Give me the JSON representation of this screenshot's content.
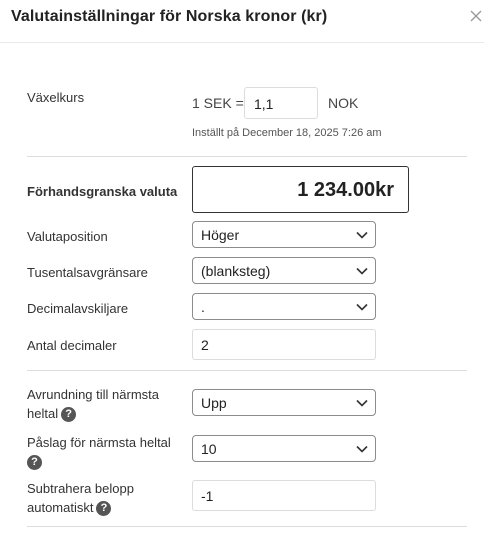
{
  "dialog": {
    "title": "Valutainställningar för Norska kronor (kr)"
  },
  "exchange": {
    "label": "Växelkurs",
    "prefix": "1 SEK =",
    "value": "1,1",
    "suffix": "NOK",
    "updated": "Inställt på December 18, 2025 7:26 am"
  },
  "preview": {
    "label": "Förhandsgranska valuta",
    "value": "1 234.00kr"
  },
  "position": {
    "label": "Valutaposition",
    "value": "Höger"
  },
  "thousands": {
    "label": "Tusentalsavgränsare",
    "value": "(blanksteg)"
  },
  "decimal_sep": {
    "label": "Decimalavskiljare",
    "value": "."
  },
  "decimals": {
    "label": "Antal decimaler",
    "value": "2"
  },
  "rounding": {
    "label_line1": "Avrundning till närmsta",
    "label_line2": "heltal",
    "value": "Upp"
  },
  "markup": {
    "label_line1": "Påslag för närmsta heltal",
    "value": "10"
  },
  "subtract": {
    "label_line1": "Subtrahera belopp",
    "label_line2": "automatiskt",
    "value": "-1"
  },
  "help_glyph": "?"
}
